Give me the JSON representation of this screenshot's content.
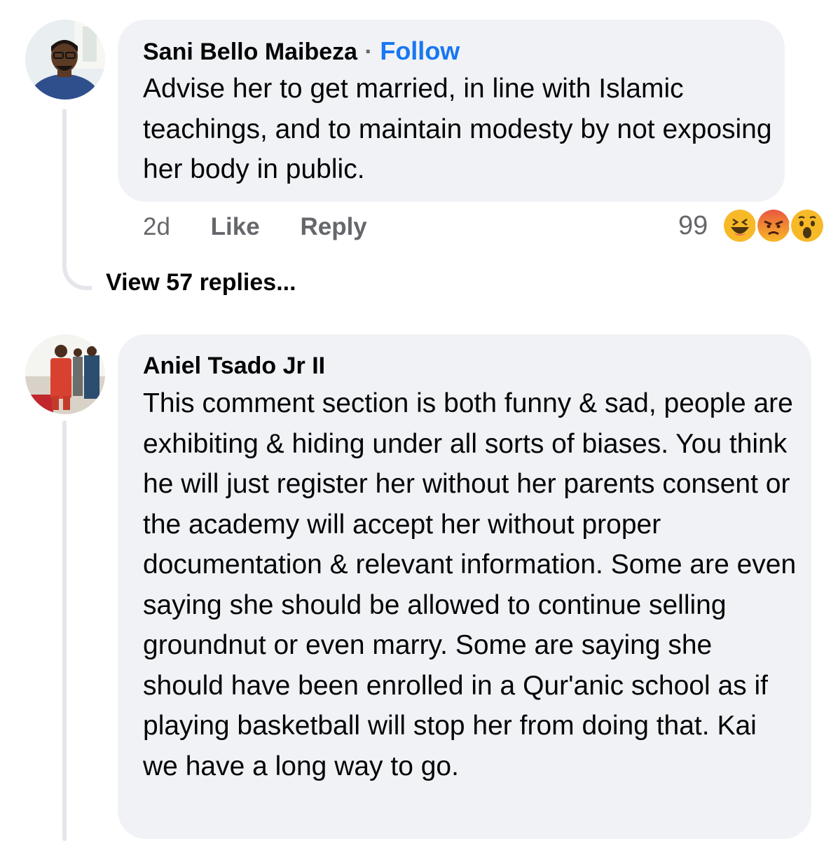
{
  "comments": [
    {
      "author": "Sani Bello Maibeza",
      "separator": "·",
      "follow_label": "Follow",
      "text": "Advise her to get married, in line with Islamic teachings, and to maintain modesty by not exposing her body in public.",
      "time": "2d",
      "like_label": "Like",
      "reply_label": "Reply",
      "reaction_count": "99",
      "reactions": [
        "haha-icon",
        "angry-icon",
        "wow-icon"
      ],
      "view_replies": "View 57 replies..."
    },
    {
      "author": "Aniel Tsado Jr II",
      "text": "This comment section is both funny & sad, people are exhibiting & hiding under all sorts of biases. You think he will just register her without her parents consent or the academy will accept her without proper documentation & relevant information. Some are even saying she should be allowed to continue selling groundnut or even marry. Some are saying she should have been enrolled in a Qur'anic school as if playing basketball will stop her from doing that. Kai we have a long way to go."
    }
  ],
  "colors": {
    "bubble": "#f0f2f5",
    "follow": "#1877f2",
    "meta": "#65676b",
    "thread_line": "#e4e6eb"
  }
}
